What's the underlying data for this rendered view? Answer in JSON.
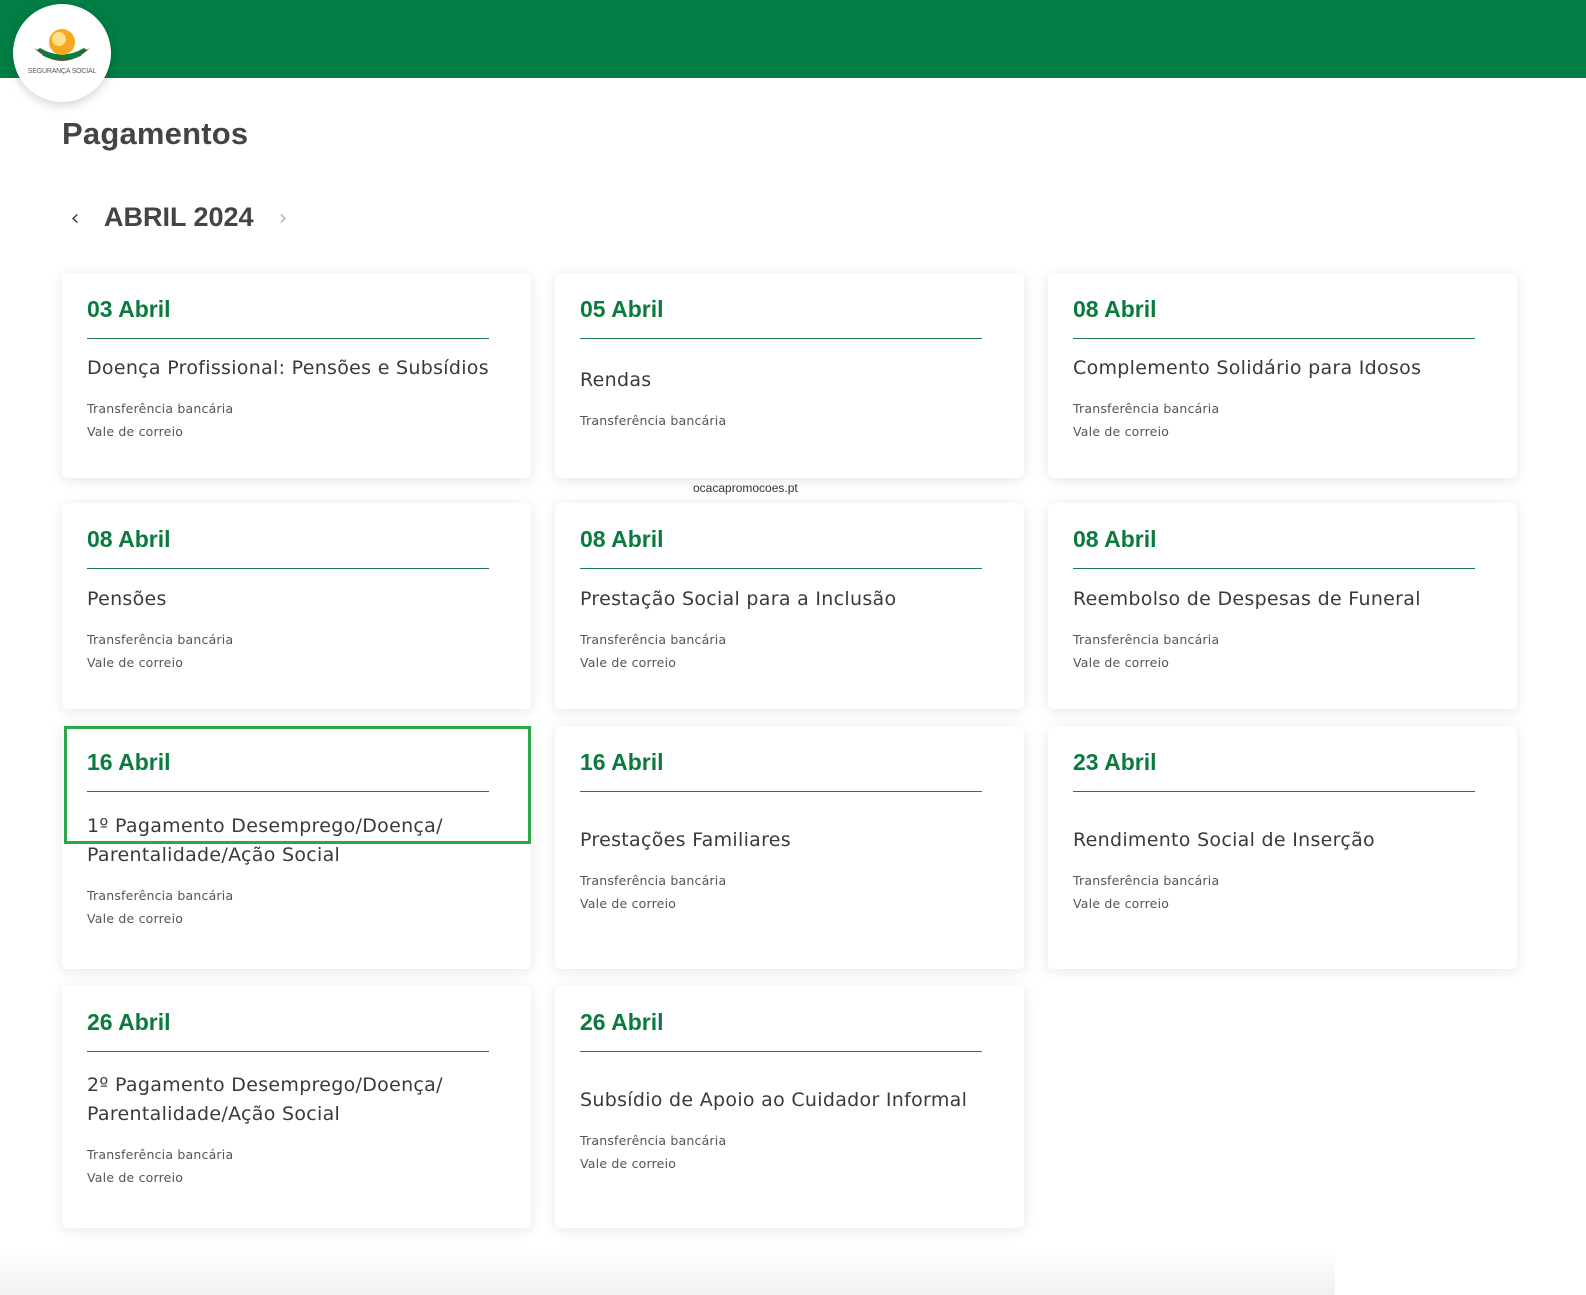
{
  "header": {
    "logo_text": "SEGURANÇA SOCIAL",
    "brand_color": "#007e44"
  },
  "page_title": "Pagamentos",
  "month_nav": {
    "month_label": "ABRIL 2024",
    "prev_icon": "chevron-left-icon",
    "next_icon": "chevron-right-icon"
  },
  "watermark": "ocacapromocoes.pt",
  "cards": [
    {
      "date": "03 Abril",
      "title": "Doença Profissional: Pensões e Subsídios",
      "methods": [
        "Transferência bancária",
        "Vale de correio"
      ]
    },
    {
      "date": "05 Abril",
      "title": "Rendas",
      "methods": [
        "Transferência bancária"
      ]
    },
    {
      "date": "08 Abril",
      "title": "Complemento Solidário para Idosos",
      "methods": [
        "Transferência bancária",
        "Vale de correio"
      ]
    },
    {
      "date": "08 Abril",
      "title": "Pensões",
      "methods": [
        "Transferência bancária",
        "Vale de correio"
      ]
    },
    {
      "date": "08 Abril",
      "title": "Prestação Social para a Inclusão",
      "methods": [
        "Transferência bancária",
        "Vale de correio"
      ]
    },
    {
      "date": "08 Abril",
      "title": "Reembolso de Despesas de Funeral",
      "methods": [
        "Transferência bancária",
        "Vale de correio"
      ]
    },
    {
      "date": "16 Abril",
      "title": "1º Pagamento Desemprego/Doença/ Parentalidade/Ação Social",
      "methods": [
        "Transferência bancária",
        "Vale de correio"
      ]
    },
    {
      "date": "16 Abril",
      "title": "Prestações Familiares",
      "methods": [
        "Transferência bancária",
        "Vale de correio"
      ]
    },
    {
      "date": "23 Abril",
      "title": "Rendimento Social de Inserção",
      "methods": [
        "Transferência bancária",
        "Vale de correio"
      ]
    },
    {
      "date": "26 Abril",
      "title": "2º Pagamento Desemprego/Doença/ Parentalidade/Ação Social",
      "methods": [
        "Transferência bancária",
        "Vale de correio"
      ]
    },
    {
      "date": "26 Abril",
      "title": "Subsídio de Apoio ao Cuidador Informal",
      "methods": [
        "Transferência bancária",
        "Vale de correio"
      ]
    }
  ]
}
